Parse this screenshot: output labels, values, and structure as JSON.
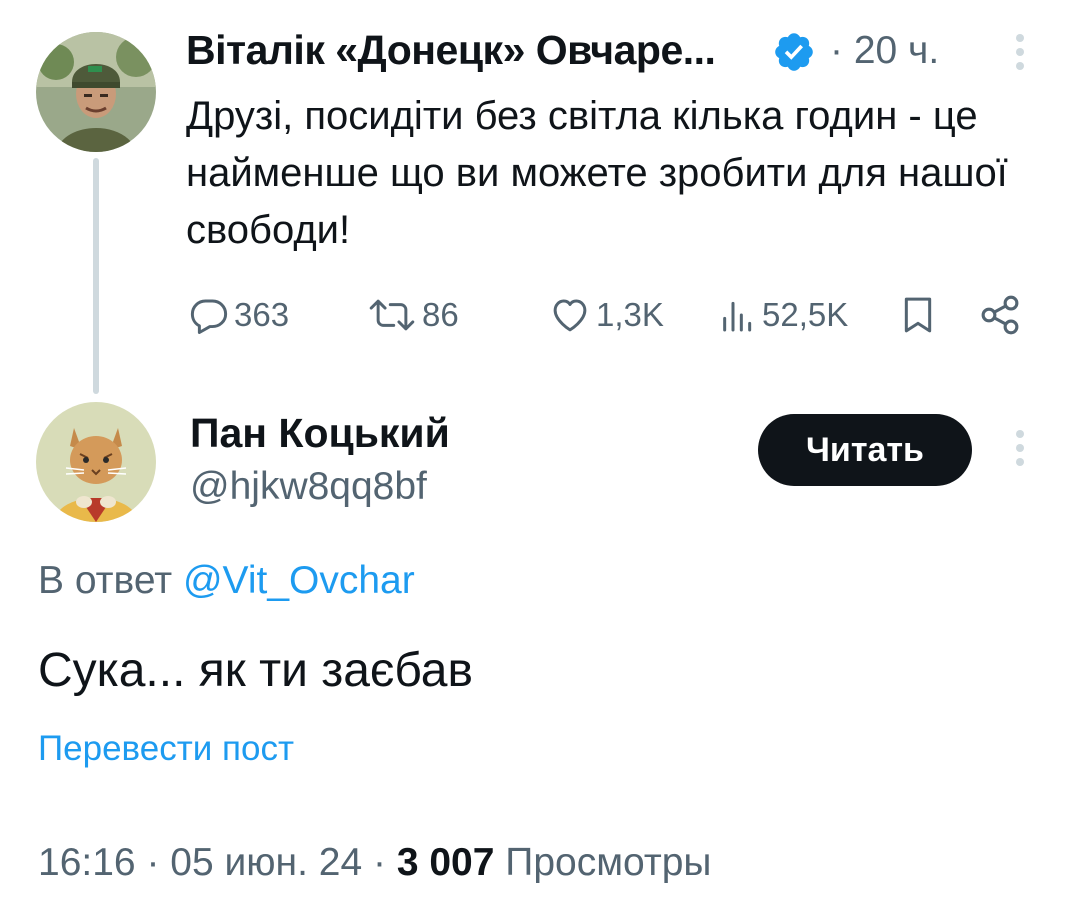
{
  "parent_tweet": {
    "author_name": "Віталік «Донецк» Овчаре...",
    "separator": "·",
    "time": "20 ч.",
    "text": "Друзі, посидіти без світла кілька годин - це найменше що ви можете зробити для нашої свободи!",
    "actions": {
      "replies": "363",
      "retweets": "86",
      "likes": "1,3K",
      "views": "52,5K"
    }
  },
  "reply_tweet": {
    "author_name": "Пан Коцький",
    "handle": "@hjkw8qq8bf",
    "follow_label": "Читать",
    "reply_to_prefix": "В ответ",
    "reply_to_handle": "@Vit_Ovchar",
    "text": "Сука... як ти заєбав",
    "translate_label": "Перевести пост",
    "time": "16:16",
    "date": "05 июн. 24",
    "sep": "·",
    "views_count": "3 007",
    "views_label": "Просмотры"
  },
  "colors": {
    "text_primary": "#0f1419",
    "text_secondary": "#536471",
    "accent": "#1d9bf0",
    "thread_line": "#cfd9de",
    "button_bg": "#0f1419"
  }
}
